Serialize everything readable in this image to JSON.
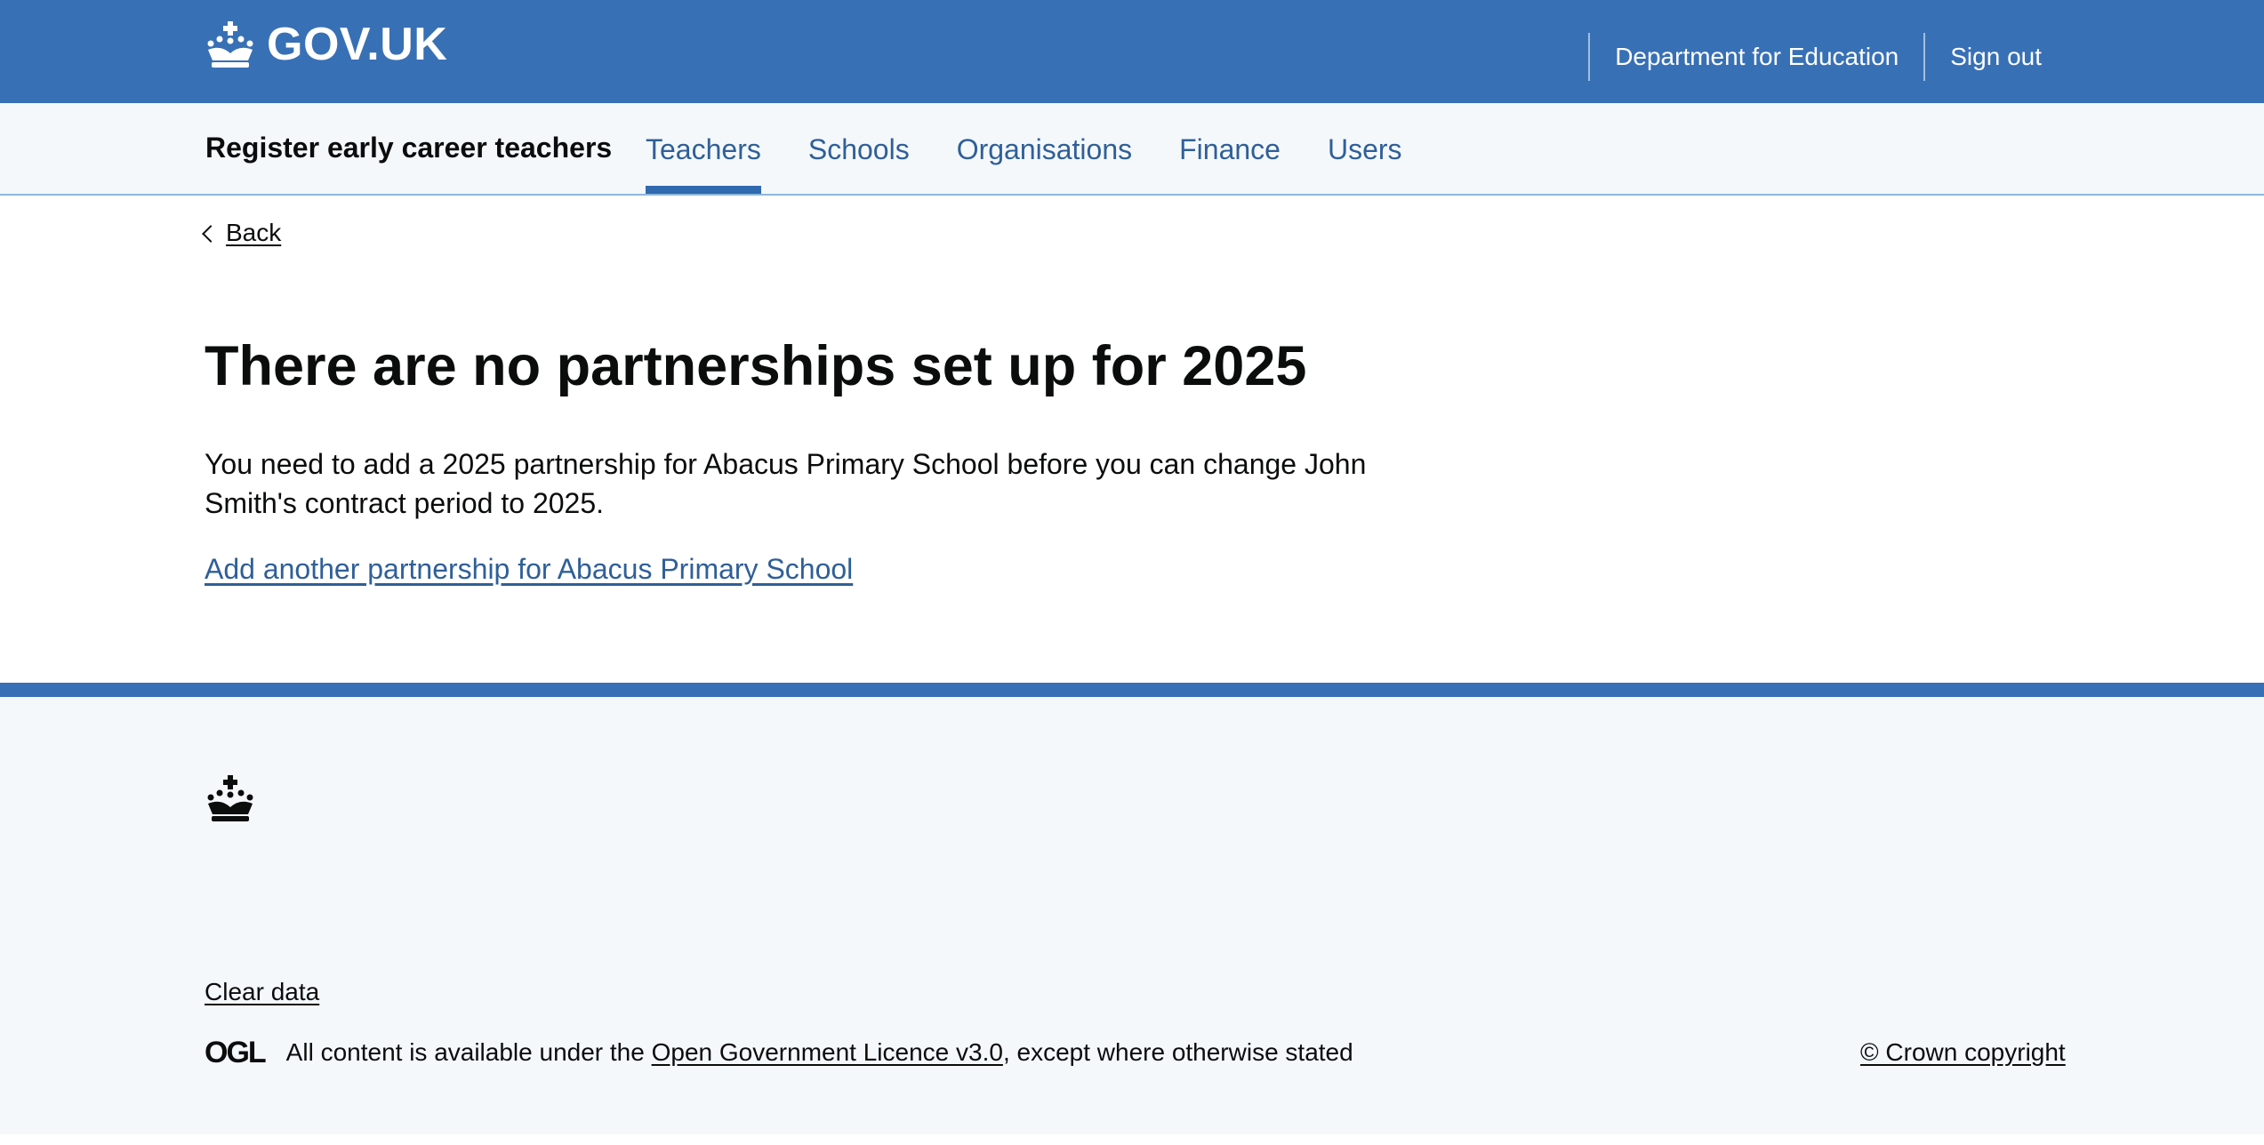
{
  "header": {
    "logo_text": "GOV.UK",
    "links": [
      {
        "label": "Department for Education"
      },
      {
        "label": "Sign out"
      }
    ]
  },
  "service_nav": {
    "service_name": "Register early career teachers",
    "items": [
      {
        "label": "Teachers",
        "active": true
      },
      {
        "label": "Schools",
        "active": false
      },
      {
        "label": "Organisations",
        "active": false
      },
      {
        "label": "Finance",
        "active": false
      },
      {
        "label": "Users",
        "active": false
      }
    ]
  },
  "main": {
    "back_label": "Back",
    "title": "There are no partnerships set up for 2025",
    "body": "You need to add a 2025 partnership for Abacus Primary School before you can change John Smith's contract period to 2025.",
    "action_link": "Add another partnership for Abacus Primary School"
  },
  "footer": {
    "clear_data": "Clear data",
    "ogl_logo": "OGL",
    "licence_prefix": "All content is available under the ",
    "licence_link": "Open Government Licence v3.0",
    "licence_suffix": ", except where otherwise stated",
    "copyright": "© Crown copyright"
  },
  "colors": {
    "header_bg": "#3870b5",
    "nav_bg": "#f4f8fb",
    "link": "#2f5f98",
    "text": "#0b0c0c"
  }
}
